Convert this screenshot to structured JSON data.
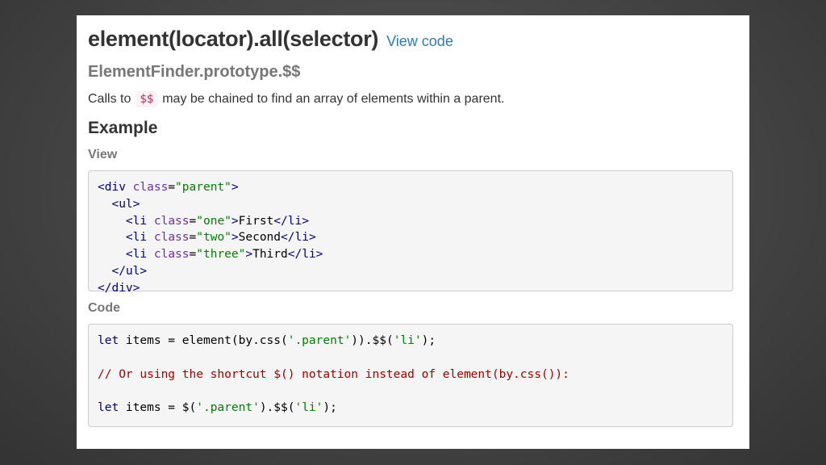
{
  "header": {
    "title": "element(locator).all(selector)",
    "view_code_link": "View code",
    "subtitle": "ElementFinder.prototype.$$"
  },
  "description": {
    "before": "Calls to",
    "code": "$$",
    "after": "may be chained to find an array of elements within a parent."
  },
  "example": {
    "heading": "Example",
    "view_label": "View",
    "code_label": "Code",
    "view_lines": [
      "<div class=\"parent\">",
      "  <ul>",
      "    <li class=\"one\">First</li>",
      "    <li class=\"two\">Second</li>",
      "    <li class=\"three\">Third</li>",
      "  </ul>",
      "</div>"
    ],
    "code_lines": [
      "let items = element(by.css('.parent')).$$('li');",
      "",
      "// Or using the shortcut $() notation instead of element(by.css()):",
      "",
      "let items = $('.parent').$$('li');"
    ]
  },
  "colors": {
    "link": "#2a7ab8",
    "inline_code": "#c7254e",
    "tag": "#000080",
    "attribute": "#6f2da8",
    "string": "#008000",
    "comment": "#a00000"
  }
}
